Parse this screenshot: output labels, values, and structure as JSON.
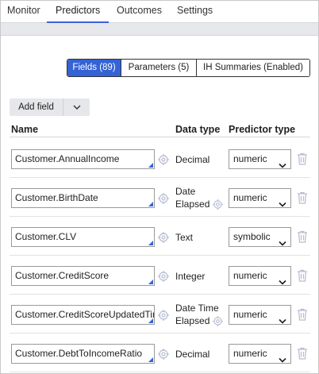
{
  "tabs": [
    {
      "label": "Monitor",
      "active": false
    },
    {
      "label": "Predictors",
      "active": true
    },
    {
      "label": "Outcomes",
      "active": false
    },
    {
      "label": "Settings",
      "active": false
    }
  ],
  "segments": [
    {
      "label": "Fields (89)",
      "active": true
    },
    {
      "label": "Parameters (5)",
      "active": false
    },
    {
      "label": "IH Summaries (Enabled)",
      "active": false
    }
  ],
  "add_field": {
    "label": "Add field",
    "icon": "chevron-down-icon"
  },
  "columns": {
    "name": "Name",
    "data_type": "Data type",
    "predictor_type": "Predictor type"
  },
  "rows": [
    {
      "name": "Customer.AnnualIncome",
      "data_type": "Decimal",
      "data_type_line2": "",
      "predictor_type": "numeric"
    },
    {
      "name": "Customer.BirthDate",
      "data_type": "Date",
      "data_type_line2": "Elapsed",
      "predictor_type": "numeric"
    },
    {
      "name": "Customer.CLV",
      "data_type": "Text",
      "data_type_line2": "",
      "predictor_type": "symbolic"
    },
    {
      "name": "Customer.CreditScore",
      "data_type": "Integer",
      "data_type_line2": "",
      "predictor_type": "numeric"
    },
    {
      "name": "Customer.CreditScoreUpdatedTime",
      "data_type": "Date Time",
      "data_type_line2": "Elapsed",
      "predictor_type": "numeric"
    },
    {
      "name": "Customer.DebtToIncomeRatio",
      "data_type": "Decimal",
      "data_type_line2": "",
      "predictor_type": "numeric"
    }
  ],
  "colors": {
    "accent": "#3463d6",
    "tab_underline": "#3f5fdc",
    "muted_icon": "#b7bcd0"
  }
}
